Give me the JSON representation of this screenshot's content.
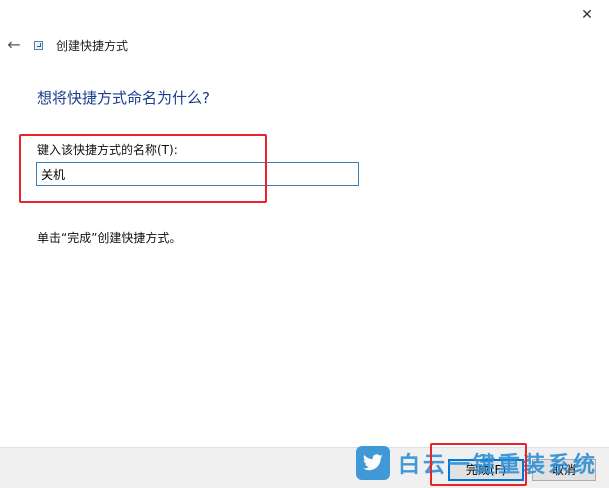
{
  "window": {
    "close_glyph": "✕",
    "back_glyph": "←",
    "title": "创建快捷方式"
  },
  "main": {
    "heading": "想将快捷方式命名为什么?",
    "field_label": "键入该快捷方式的名称(T):",
    "name_value": "关机",
    "hint": "单击“完成”创建快捷方式。"
  },
  "footer": {
    "finish_label": "完成(F)",
    "cancel_label": "取消"
  },
  "watermark": {
    "text": "白云一键重装系统",
    "logo_icon": "bird-icon"
  },
  "colors": {
    "heading": "#1a3e8c",
    "highlight": "#e8242b",
    "accent": "#0078d7"
  }
}
